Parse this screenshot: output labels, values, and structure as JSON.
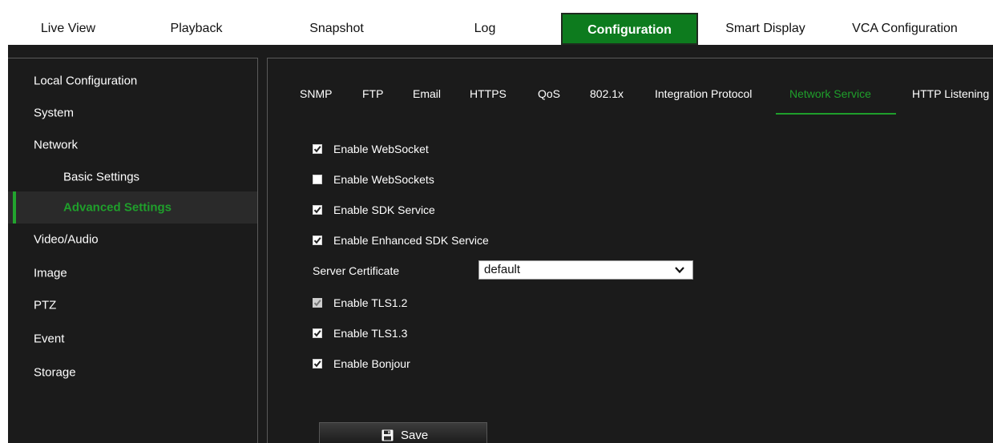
{
  "topnav": {
    "tabs": [
      {
        "label": "Live View"
      },
      {
        "label": "Playback"
      },
      {
        "label": "Snapshot"
      },
      {
        "label": "Log"
      },
      {
        "label": "Configuration",
        "active": true
      },
      {
        "label": "Smart Display"
      },
      {
        "label": "VCA Configuration"
      }
    ]
  },
  "sidebar": {
    "items": [
      {
        "label": "Local Configuration"
      },
      {
        "label": "System"
      },
      {
        "label": "Network"
      },
      {
        "label": "Basic Settings"
      },
      {
        "label": "Advanced Settings",
        "active": true
      },
      {
        "label": "Video/Audio"
      },
      {
        "label": "Image"
      },
      {
        "label": "PTZ"
      },
      {
        "label": "Event"
      },
      {
        "label": "Storage"
      }
    ]
  },
  "subtabs": [
    {
      "label": "SNMP"
    },
    {
      "label": "FTP"
    },
    {
      "label": "Email"
    },
    {
      "label": "HTTPS"
    },
    {
      "label": "QoS"
    },
    {
      "label": "802.1x"
    },
    {
      "label": "Integration Protocol"
    },
    {
      "label": "Network Service",
      "active": true
    },
    {
      "label": "HTTP Listening"
    }
  ],
  "options": [
    {
      "label": "Enable WebSocket",
      "checked": true
    },
    {
      "label": "Enable WebSockets",
      "checked": false
    },
    {
      "label": "Enable SDK Service",
      "checked": true
    },
    {
      "label": "Enable Enhanced SDK Service",
      "checked": true
    },
    {
      "label": "Enable TLS1.2",
      "checked": true,
      "disabled": true
    },
    {
      "label": "Enable TLS1.3",
      "checked": true
    },
    {
      "label": "Enable Bonjour",
      "checked": true
    }
  ],
  "server_certificate": {
    "label": "Server Certificate",
    "value": "default"
  },
  "save_label": "Save",
  "colors": {
    "accent": "#1f9f2b",
    "active_tab_bg": "#0d7b1e",
    "panel_bg": "#1b1b1b"
  },
  "icons": {
    "checkbox": "check-icon",
    "select": "chevron-down-icon",
    "save": "floppy-disk-icon"
  }
}
